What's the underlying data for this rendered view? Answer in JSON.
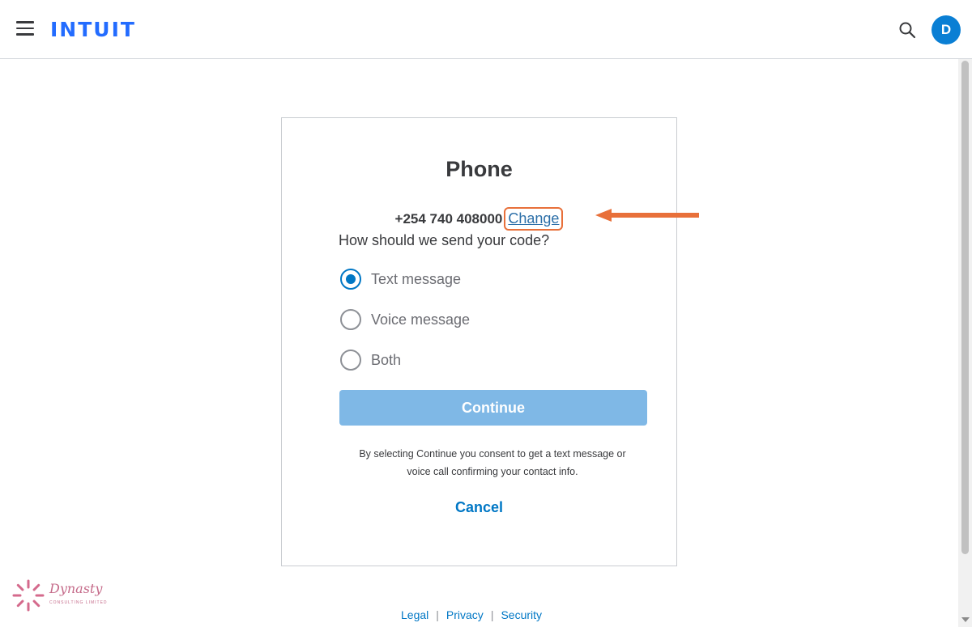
{
  "header": {
    "logo": "INTUIT",
    "avatar_initial": "D"
  },
  "card": {
    "title": "Phone",
    "phone_number": "+254 740 408000",
    "change_label": "Change",
    "question": "How should we send your code?",
    "options": [
      {
        "label": "Text message",
        "selected": true
      },
      {
        "label": "Voice message",
        "selected": false
      },
      {
        "label": "Both",
        "selected": false
      }
    ],
    "continue_label": "Continue",
    "consent_line1": "By selecting Continue you consent to get a text message or",
    "consent_line2": "voice call confirming your contact info.",
    "cancel_label": "Cancel"
  },
  "footer": {
    "links": [
      "Legal",
      "Privacy",
      "Security"
    ]
  },
  "watermark": {
    "name": "Dynasty",
    "subtitle": "CONSULTING LIMITED"
  },
  "colors": {
    "brand": "#236cff",
    "accent": "#0077c5",
    "annotation": "#e8703a",
    "continue_disabled": "#7fb8e6"
  },
  "icons": [
    "menu-icon",
    "search-icon",
    "arrow-left-icon"
  ]
}
